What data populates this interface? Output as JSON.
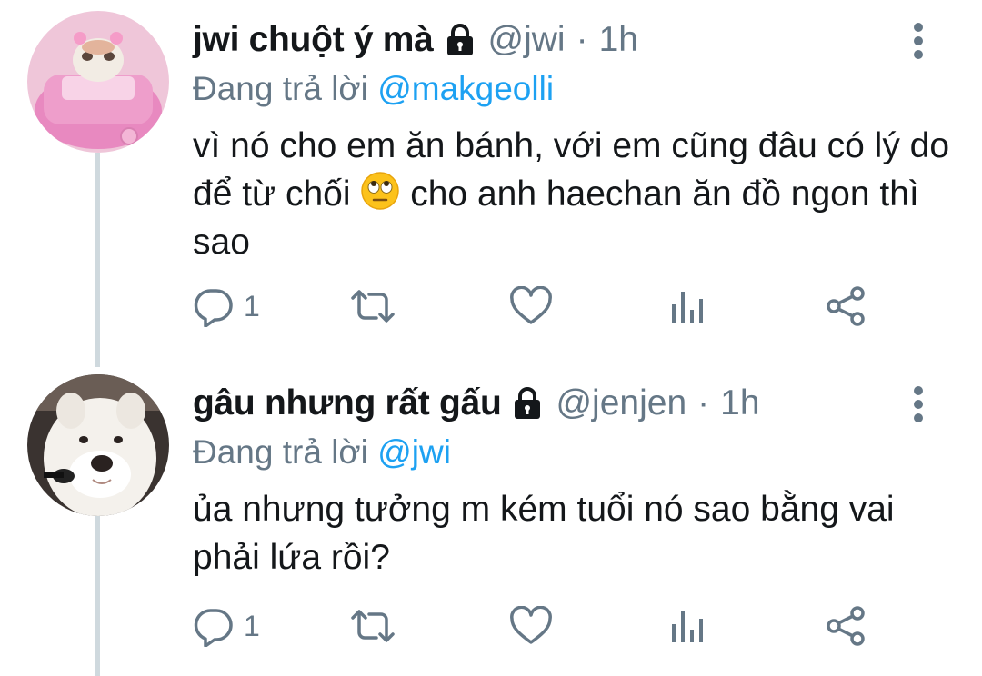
{
  "tweets": [
    {
      "display_name": "jwi chuột ý mà",
      "handle": "@jwi",
      "separator": "·",
      "time": "1h",
      "reply_prefix": "Đang trả lời",
      "reply_to": "@makgeolli",
      "text_before_emoji": "vì nó cho em ăn bánh, với em cũng đâu có lý do để từ chối",
      "emoji": "🙄",
      "text_after_emoji": "cho anh haechan ăn đồ ngon thì sao",
      "reply_count": "1"
    },
    {
      "display_name": "gâu nhưng rất gấu",
      "handle": "@jenjen",
      "separator": "·",
      "time": "1h",
      "reply_prefix": "Đang trả lời",
      "reply_to": "@jwi",
      "text": "ủa nhưng tưởng m kém tuổi nó sao bằng vai phải lứa rồi?",
      "reply_count": "1"
    }
  ],
  "icons": {
    "lock": "lock-icon",
    "more": "more-vertical-icon",
    "reply": "reply-icon",
    "retweet": "retweet-icon",
    "like": "heart-icon",
    "analytics": "analytics-icon",
    "share": "share-icon"
  },
  "colors": {
    "text": "#14171a",
    "secondary": "#657786",
    "link": "#1da1f2",
    "thread_line": "#cfd9de"
  }
}
